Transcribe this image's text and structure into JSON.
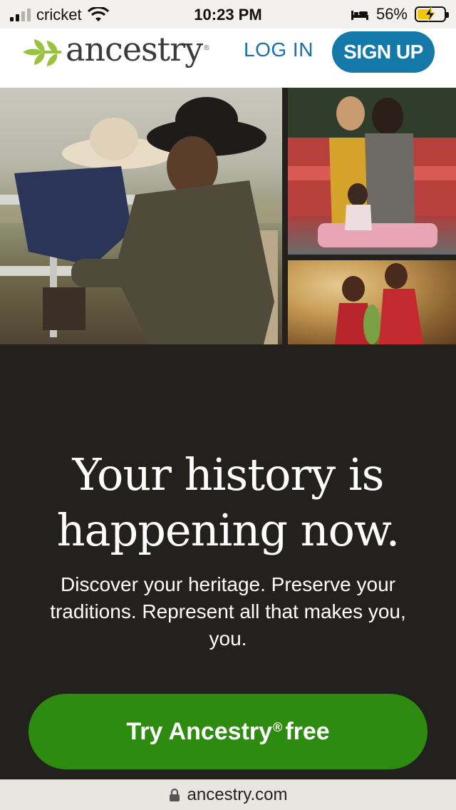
{
  "status_bar": {
    "carrier": "cricket",
    "time": "10:23 PM",
    "battery_percent": "56%",
    "battery_level": 0.56,
    "icons": [
      "signal-icon",
      "wifi-icon",
      "bed-icon",
      "battery-charging-icon"
    ]
  },
  "header": {
    "logo_text": "ancestry",
    "logo_tm": "®",
    "login_label": "LOG IN",
    "signup_label": "SIGN UP"
  },
  "hero": {
    "headline_line1": "Your history is",
    "headline_line2": "happening now.",
    "subtext": "Discover your heritage. Preserve your traditions. Represent all that makes you, you.",
    "cta_prefix": "Try Ancestry",
    "cta_reg": "®",
    "cta_suffix": "free"
  },
  "url_bar": {
    "domain": "ancestry.com"
  },
  "colors": {
    "brand_blue": "#1479a8",
    "cta_green": "#2d8c0f",
    "logo_green": "#9bc23c",
    "hero_background": "#23211e"
  }
}
